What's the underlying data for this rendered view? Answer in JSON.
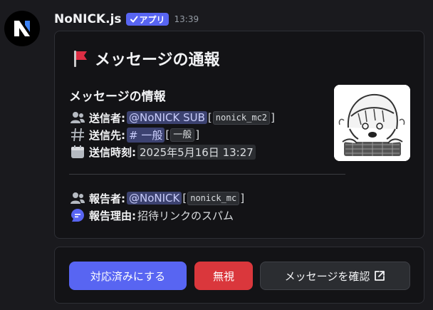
{
  "message": {
    "bot_name": "NoNICK.js",
    "badge_label": "アプリ",
    "timestamp": "13:39"
  },
  "embed": {
    "title": "メッセージの通報",
    "section_title": "メッセージの情報",
    "sender": {
      "label": "送信者:",
      "mention": "@NoNICK SUB",
      "username": "nonick_mc2"
    },
    "channel": {
      "label": "送信先:",
      "mention": "# 一般",
      "name": "一般"
    },
    "sent_at": {
      "label": "送信時刻:",
      "value": "2025年5月16日 13:27"
    },
    "reporter": {
      "label": "報告者:",
      "mention": "@NoNICK",
      "username": "nonick_mc"
    },
    "reason": {
      "label": "報告理由:",
      "value": "招待リンクのスパム"
    }
  },
  "buttons": {
    "resolve": "対応済みにする",
    "ignore": "無視",
    "view_message": "メッセージを確認"
  },
  "colors": {
    "blurple": "#5865f2",
    "danger": "#da373c",
    "background": "#1a1a1e",
    "embed_background": "#131316"
  },
  "icons": {
    "avatar": "nonick-logo",
    "title": "red-flag",
    "sender": "members-icon",
    "channel": "channel-hash-icon",
    "time": "calendar-icon",
    "reporter": "members-icon",
    "reason": "chat-bubble-icon",
    "view_message": "external-link-icon"
  }
}
